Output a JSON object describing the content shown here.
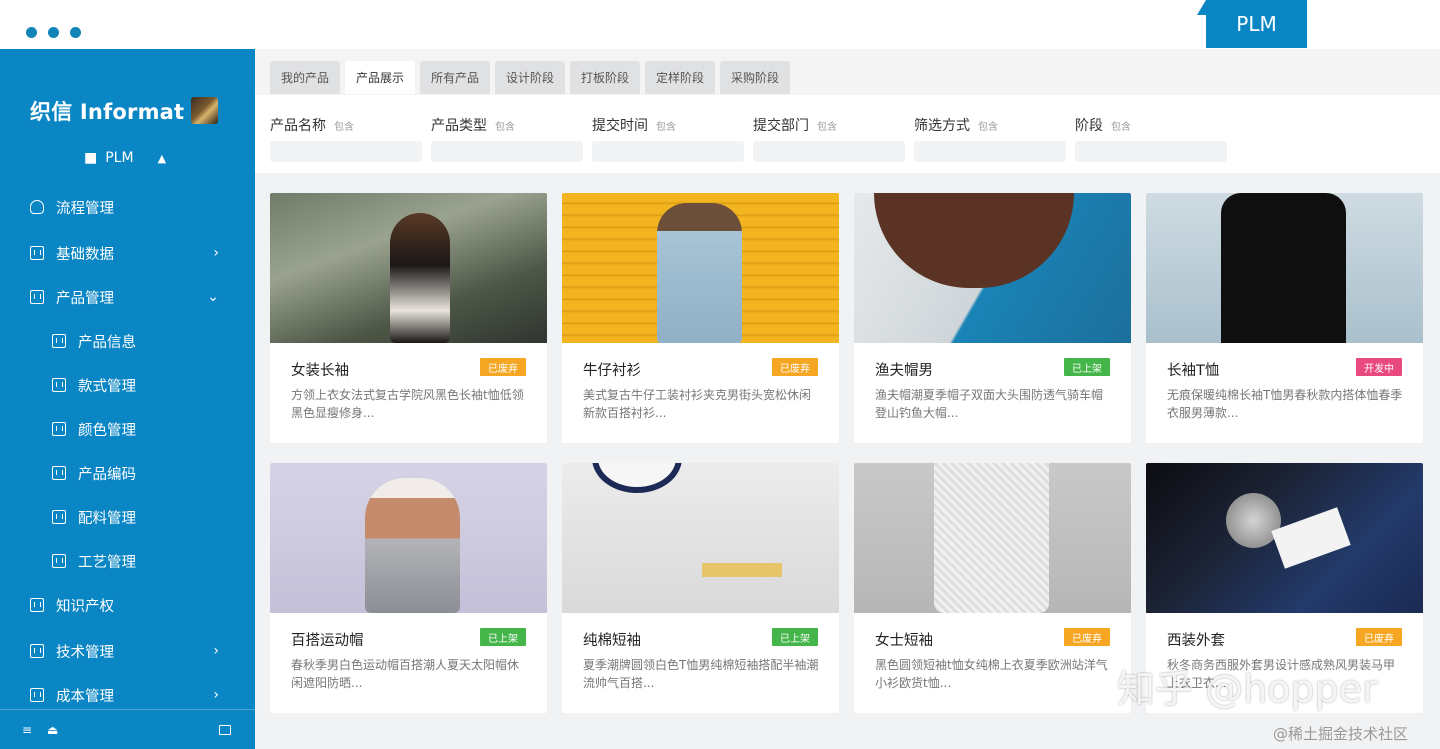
{
  "topbar": {
    "app_tab": "PLM"
  },
  "sidebar": {
    "brand": "织信 Informat",
    "app_name": "PLM",
    "menu": [
      {
        "label": "流程管理",
        "icon": "user-flow-icon",
        "arrow": ""
      },
      {
        "label": "基础数据",
        "icon": "data-icon",
        "arrow": "›"
      },
      {
        "label": "产品管理",
        "icon": "product-icon",
        "arrow": "⌄"
      },
      {
        "label": "产品信息",
        "icon": "grid-icon",
        "arrow": ""
      },
      {
        "label": "款式管理",
        "icon": "grid-icon",
        "arrow": ""
      },
      {
        "label": "颜色管理",
        "icon": "grid-icon",
        "arrow": ""
      },
      {
        "label": "产品编码",
        "icon": "grid-icon",
        "arrow": ""
      },
      {
        "label": "配料管理",
        "icon": "grid-icon",
        "arrow": ""
      },
      {
        "label": "工艺管理",
        "icon": "grid-icon",
        "arrow": ""
      },
      {
        "label": "知识产权",
        "icon": "grid-icon",
        "arrow": ""
      },
      {
        "label": "技术管理",
        "icon": "grid-icon",
        "arrow": "›"
      },
      {
        "label": "成本管理",
        "icon": "grid-icon",
        "arrow": "›"
      }
    ]
  },
  "tabs": [
    "我的产品",
    "产品展示",
    "所有产品",
    "设计阶段",
    "打板阶段",
    "定样阶段",
    "采购阶段"
  ],
  "filters": [
    {
      "label": "产品名称",
      "tag": "包含"
    },
    {
      "label": "产品类型",
      "tag": "包含"
    },
    {
      "label": "提交时间",
      "tag": "包含"
    },
    {
      "label": "提交部门",
      "tag": "包含"
    },
    {
      "label": "筛选方式",
      "tag": "包含"
    },
    {
      "label": "阶段",
      "tag": "包含"
    }
  ],
  "cards": [
    {
      "title": "女装长袖",
      "badge": "已废弃",
      "badge_color": "#f5a623",
      "desc": "方领上衣女法式复古学院风黑色长袖t恤低领黑色显瘦修身..."
    },
    {
      "title": "牛仔衬衫",
      "badge": "已废弃",
      "badge_color": "#f5a623",
      "desc": "美式复古牛仔工装衬衫夹克男街头宽松休闲新款百搭衬衫..."
    },
    {
      "title": "渔夫帽男",
      "badge": "已上架",
      "badge_color": "#44b549",
      "desc": "渔夫帽潮夏季帽子双面大头围防透气骑车帽登山钓鱼大帽..."
    },
    {
      "title": "长袖T恤",
      "badge": "开发中",
      "badge_color": "#e84a7f",
      "desc": "无痕保暖纯棉长袖T恤男春秋款内搭体恤春季衣服男薄款..."
    },
    {
      "title": "百搭运动帽",
      "badge": "已上架",
      "badge_color": "#44b549",
      "desc": "春秋季男白色运动帽百搭潮人夏天太阳帽休闲遮阳防晒..."
    },
    {
      "title": "纯棉短袖",
      "badge": "已上架",
      "badge_color": "#44b549",
      "desc": "夏季潮牌圆领白色T恤男纯棉短袖搭配半袖潮流帅气百搭..."
    },
    {
      "title": "女士短袖",
      "badge": "已废弃",
      "badge_color": "#f5a623",
      "desc": "黑色圆领短袖t恤女纯棉上衣夏季欧洲站洋气小衫欧货t恤..."
    },
    {
      "title": "西装外套",
      "badge": "已废弃",
      "badge_color": "#f5a623",
      "desc": "秋冬商务西服外套男设计感成熟风男装马甲上衣卫衣..."
    }
  ],
  "watermark": "知乎 @hopper",
  "watermark_source": "@稀土掘金技术社区"
}
